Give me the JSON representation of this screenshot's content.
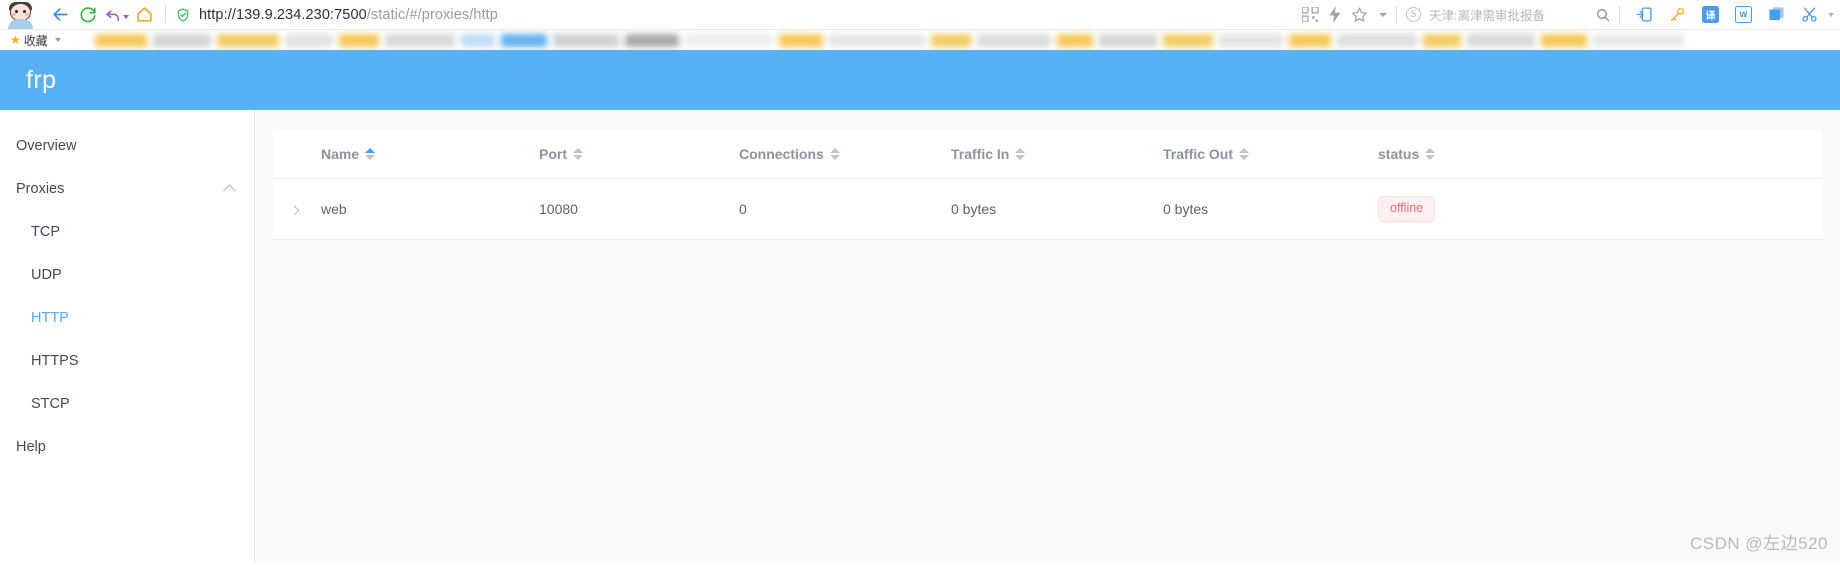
{
  "browser": {
    "url_host": "http://139.9.234.230:7500",
    "url_path": "/static/#/proxies/http",
    "back_icon": "back-arrow-icon",
    "reload_icon": "reload-icon",
    "undo_icon": "undo-arrow-icon",
    "home_icon": "home-icon",
    "shield_icon": "security-shield-icon",
    "qr_icon": "qr-code-icon",
    "bolt_icon": "lightning-bolt-icon",
    "star_icon": "star-outline-icon",
    "search_engine_badge": "S",
    "search_placeholder": "天津:离津需审批报备",
    "search_icon": "search-magnifier-icon",
    "extensions": [
      {
        "name": "phone-transfer-icon",
        "glyph": "↲"
      },
      {
        "name": "key-icon",
        "glyph": "⚷"
      },
      {
        "name": "translate-icon",
        "glyph": "译"
      },
      {
        "name": "word-doc-icon",
        "glyph": "w"
      },
      {
        "name": "window-copy-icon",
        "glyph": "◰"
      },
      {
        "name": "scissors-icon",
        "glyph": "✂"
      }
    ]
  },
  "bookmarks": {
    "star_icon": "favorites-star-icon",
    "label": "收藏",
    "dropdown_icon": "chevron-down-icon"
  },
  "app": {
    "title": "frp",
    "header_color": "#58b0f5"
  },
  "sidebar": {
    "items": [
      {
        "label": "Overview",
        "level": "top",
        "active": false
      },
      {
        "label": "Proxies",
        "level": "top",
        "active": false,
        "collapsible": true
      },
      {
        "label": "TCP",
        "level": "sub",
        "active": false
      },
      {
        "label": "UDP",
        "level": "sub",
        "active": false
      },
      {
        "label": "HTTP",
        "level": "sub",
        "active": true
      },
      {
        "label": "HTTPS",
        "level": "sub",
        "active": false
      },
      {
        "label": "STCP",
        "level": "sub",
        "active": false
      },
      {
        "label": "Help",
        "level": "top",
        "active": false
      }
    ],
    "active_color": "#54a8f0"
  },
  "table": {
    "columns": [
      {
        "key": "name",
        "label": "Name",
        "sorted": "asc"
      },
      {
        "key": "port",
        "label": "Port",
        "sorted": "none"
      },
      {
        "key": "connections",
        "label": "Connections",
        "sorted": "none"
      },
      {
        "key": "traffic_in",
        "label": "Traffic In",
        "sorted": "none"
      },
      {
        "key": "traffic_out",
        "label": "Traffic Out",
        "sorted": "none"
      },
      {
        "key": "status",
        "label": "status",
        "sorted": "none"
      }
    ],
    "rows": [
      {
        "expand_icon": "chevron-right-icon",
        "name": "web",
        "port": "10080",
        "connections": "0",
        "traffic_in": "0 bytes",
        "traffic_out": "0 bytes",
        "status": "offline",
        "status_color": "#f56c6c",
        "status_bg": "#fef0f0"
      }
    ]
  },
  "watermark": {
    "text": "CSDN @左边520"
  }
}
